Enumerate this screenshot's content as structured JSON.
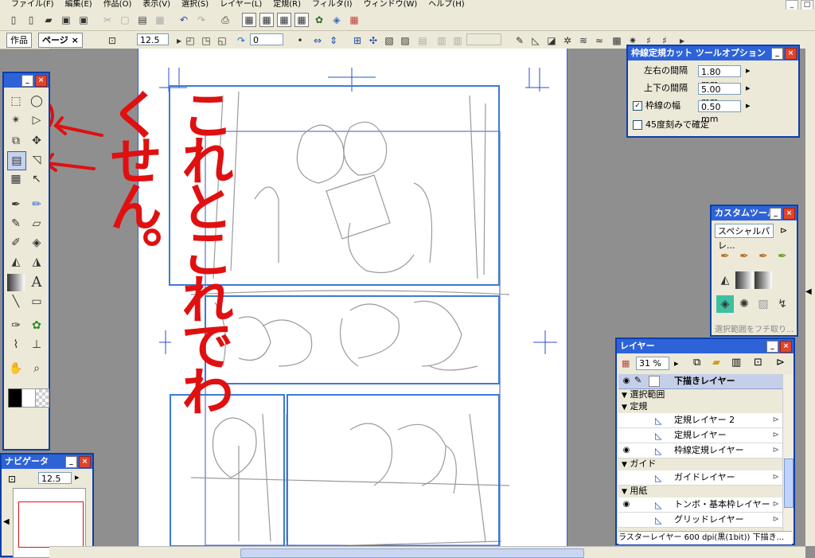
{
  "menubar": {
    "items": [
      "ファイル(F)",
      "編集(E)",
      "作品(O)",
      "表示(V)",
      "選択(S)",
      "レイヤー(L)",
      "定規(R)",
      "フィルタ(I)",
      "ウィンドウ(W)",
      "ヘルプ(H)"
    ]
  },
  "toolbar2": {
    "tab_work": "作品",
    "tab_page": "ページ ×",
    "zoom_value": "12.5",
    "rotate_value": "0"
  },
  "tools_panel": {
    "text_tool_glyph": "A"
  },
  "annotation": {
    "text": "これとこれでわくせん。",
    "color": "#e01010"
  },
  "tool_options": {
    "title": "枠線定規カット ツールオプション",
    "h_gap_label": "左右の間隔",
    "h_gap_value": "1.80 mm",
    "v_gap_label": "上下の間隔",
    "v_gap_value": "5.00 mm",
    "line_width_label": "枠線の幅",
    "line_width_value": "0.50 mm",
    "line_width_checked": true,
    "snap45_label": "45度刻みで確定",
    "snap45_checked": false
  },
  "custom_tools": {
    "title": "カスタムツール",
    "preset": "スペシャルパレ...",
    "footer": "選択範囲をフチ取り..."
  },
  "layers": {
    "title": "レイヤー",
    "zoom": "31 %",
    "active_layer": "下描きレイヤー",
    "rows": [
      {
        "type": "group",
        "label": "選択範囲"
      },
      {
        "type": "group",
        "label": "定規"
      },
      {
        "type": "layer",
        "label": "定規レイヤー 2",
        "eye": false
      },
      {
        "type": "layer",
        "label": "定規レイヤー",
        "eye": false
      },
      {
        "type": "layer",
        "label": "枠線定規レイヤー",
        "eye": true
      },
      {
        "type": "group",
        "label": "ガイド"
      },
      {
        "type": "layer",
        "label": "ガイドレイヤー",
        "eye": false
      },
      {
        "type": "group",
        "label": "用紙"
      },
      {
        "type": "layer",
        "label": "トンボ・基本枠レイヤー",
        "eye": true
      },
      {
        "type": "layer",
        "label": "グリッドレイヤー",
        "eye": false
      }
    ],
    "status": "ラスターレイヤー 600 dpi(黒(1bit)) 下描き..."
  },
  "navigator": {
    "title": "ナビゲータ",
    "zoom": "12.5"
  },
  "colors": {
    "panel_title": "#2e63d8",
    "frame_line": "#3a7bd5",
    "sketch": "#9a9a9a",
    "annotation": "#e01010"
  }
}
